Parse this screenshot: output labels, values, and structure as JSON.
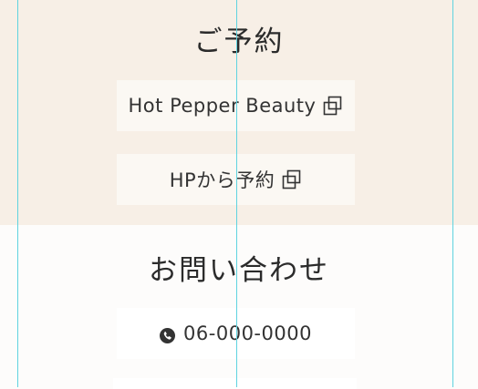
{
  "reserve": {
    "title": "ご予約",
    "hotpepper_label": "Hot Pepper Beauty",
    "hp_label": "HPから予約",
    "external_icon": "external-link-icon"
  },
  "contact": {
    "title": "お問い合わせ",
    "phone_label": "06-000-0000",
    "phone_icon": "phone-icon"
  },
  "colors": {
    "reserve_bg": "#f7efe6",
    "contact_bg": "#fdfcfb",
    "button_bg": "#fbf8f3",
    "guide_line": "#5fd3e0",
    "text": "#333333"
  }
}
